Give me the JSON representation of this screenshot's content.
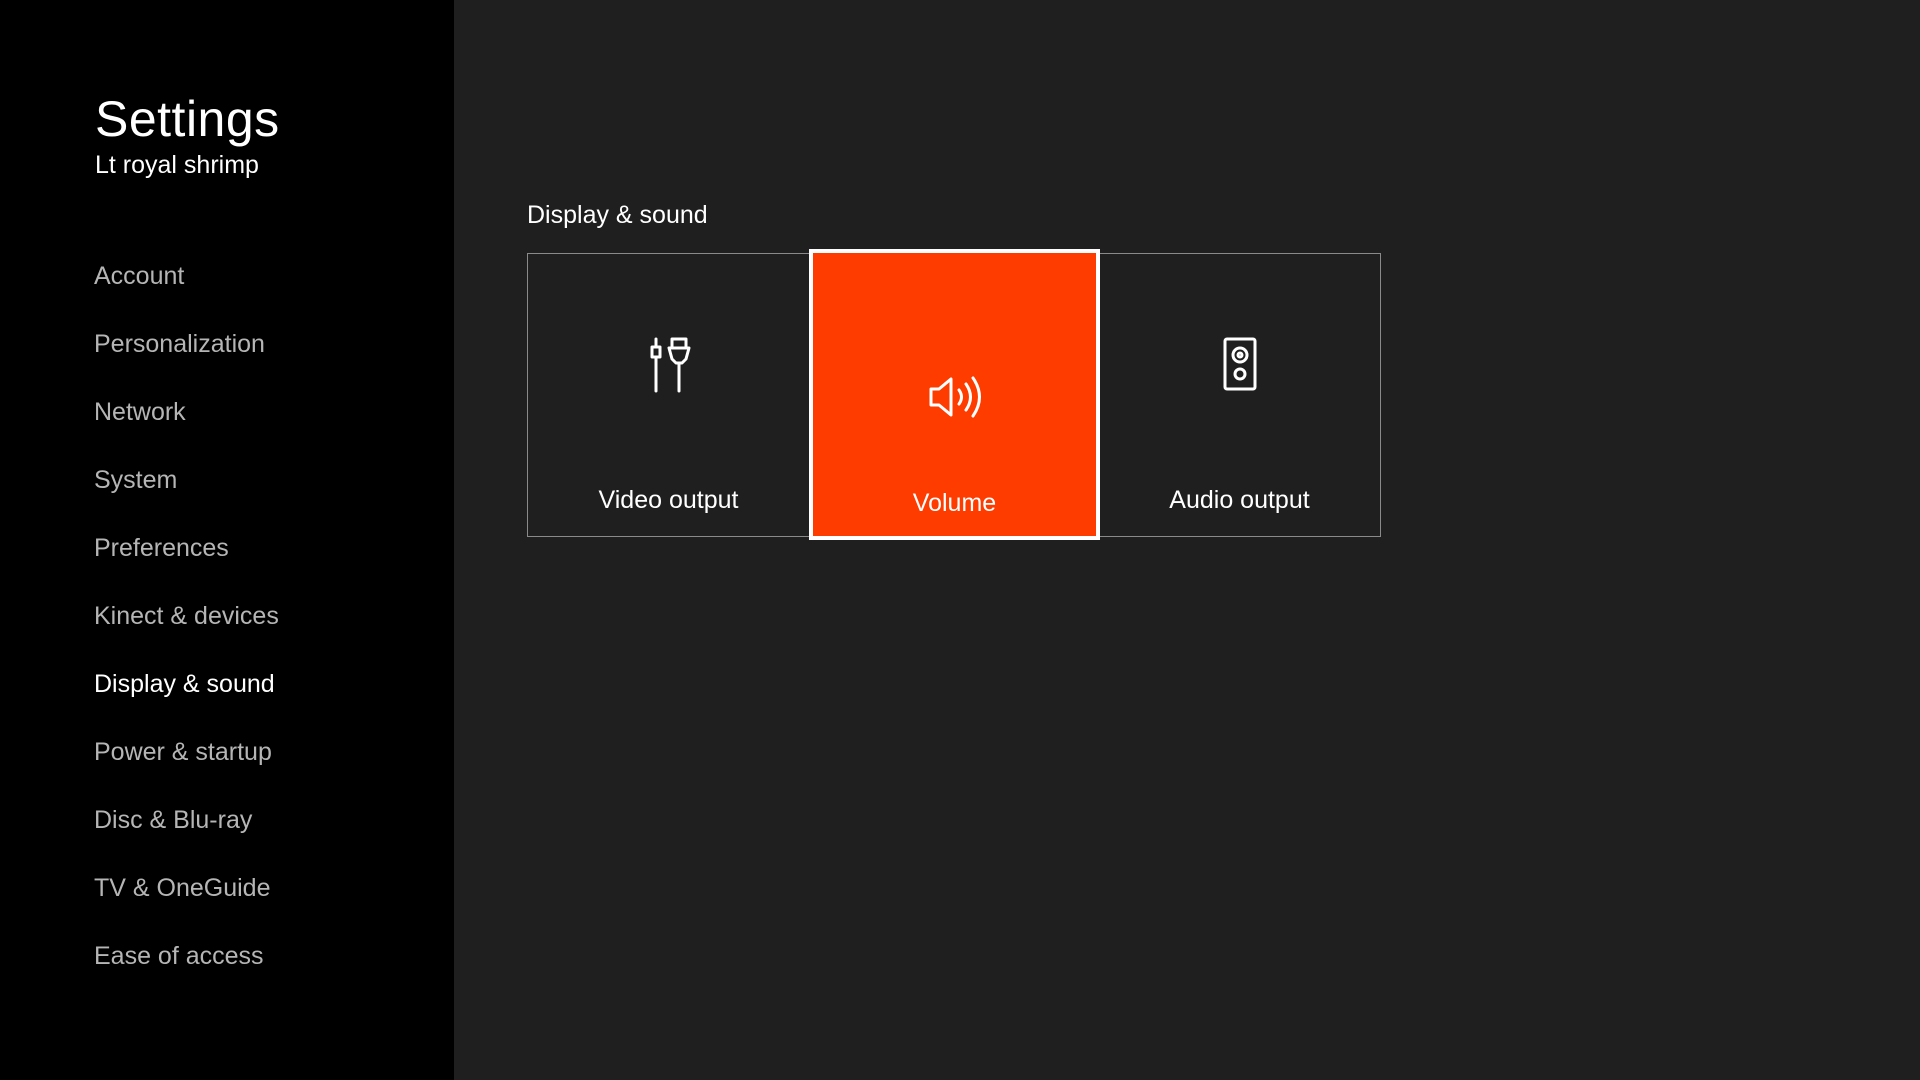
{
  "sidebar": {
    "title": "Settings",
    "profile": "Lt royal shrimp",
    "items": [
      {
        "label": "Account"
      },
      {
        "label": "Personalization"
      },
      {
        "label": "Network"
      },
      {
        "label": "System"
      },
      {
        "label": "Preferences"
      },
      {
        "label": "Kinect & devices"
      },
      {
        "label": "Display & sound",
        "selected": true
      },
      {
        "label": "Power & startup"
      },
      {
        "label": "Disc & Blu-ray"
      },
      {
        "label": "TV & OneGuide"
      },
      {
        "label": "Ease of access"
      }
    ]
  },
  "main": {
    "section_title": "Display & sound",
    "tiles": [
      {
        "label": "Video output",
        "icon": "video-cable-icon"
      },
      {
        "label": "Volume",
        "icon": "speaker-volume-icon",
        "focused": true
      },
      {
        "label": "Audio output",
        "icon": "speaker-box-icon"
      }
    ]
  },
  "colors": {
    "accent": "#ff3c00",
    "sidebar_bg": "#000000",
    "main_bg": "#1f1f1f",
    "nav_text": "#b5b5b5",
    "active_text": "#ffffff"
  }
}
